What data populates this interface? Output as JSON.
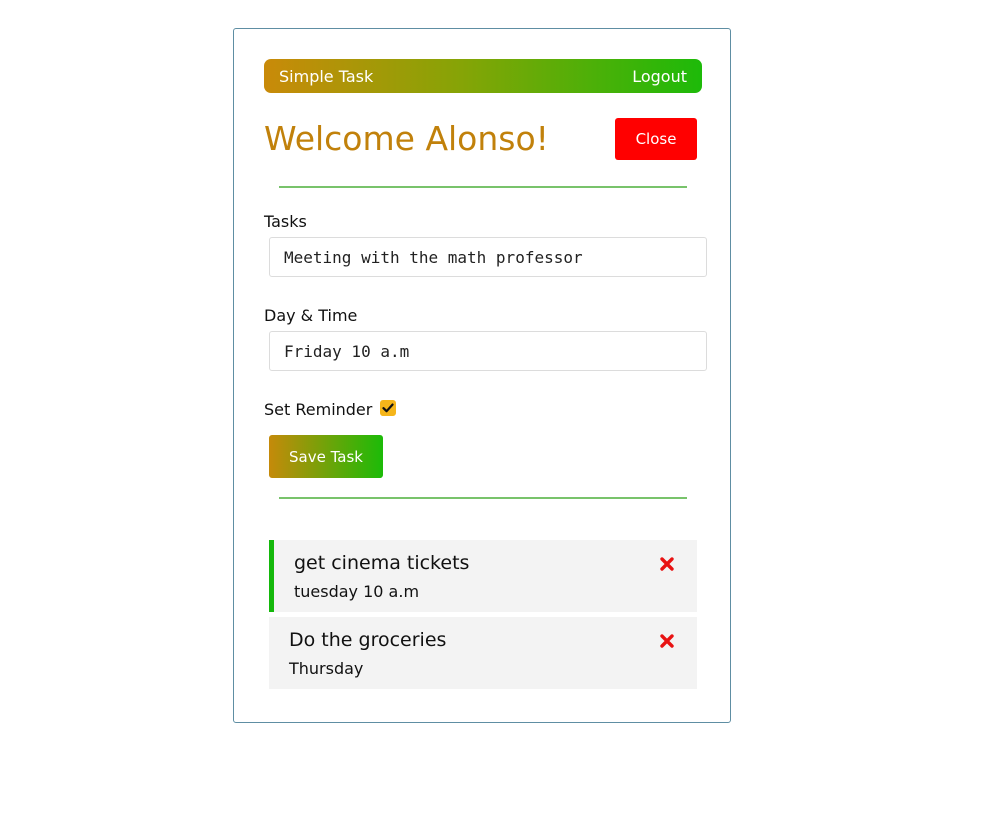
{
  "navbar": {
    "brand": "Simple Task",
    "logout_label": "Logout"
  },
  "header": {
    "welcome": "Welcome Alonso!",
    "close_label": "Close"
  },
  "form": {
    "task_label": "Tasks",
    "task_value": "Meeting with the math professor",
    "day_label": "Day & Time",
    "day_value": "Friday 10 a.m",
    "reminder_label": "Set Reminder",
    "reminder_checked": true,
    "save_label": "Save Task"
  },
  "tasks": [
    {
      "title": "get cinema tickets",
      "day": "tuesday 10 a.m",
      "reminder": true
    },
    {
      "title": "Do the groceries",
      "day": "Thursday",
      "reminder": false
    }
  ],
  "colors": {
    "accent_gold": "#c1810b",
    "accent_green": "#1dba09",
    "danger": "#ff0000",
    "checkbox": "#f5b51a"
  },
  "icons": {
    "checkbox": "check-icon",
    "delete": "times-icon"
  }
}
